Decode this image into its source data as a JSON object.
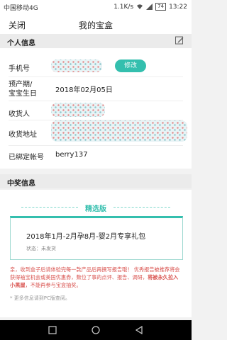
{
  "status_bar": {
    "carrier": "中国移动4G",
    "speed": "1.1K/s",
    "battery": "74",
    "time": "13:22"
  },
  "nav": {
    "close": "关闭",
    "title": "我的宝盒"
  },
  "personal": {
    "header": "个人信息",
    "phone_label": "手机号",
    "modify_button": "修改",
    "due_label_line1": "预产期/",
    "due_label_line2": "宝宝生日",
    "due_value": "2018年02月05日",
    "recipient_label": "收货人",
    "address_label": "收货地址",
    "account_label": "已绑定帐号",
    "account_value": "berry137"
  },
  "prize": {
    "header": "中奖信息",
    "tag": "精选版",
    "title": "2018年1月-2月孕8月-婴2月专享礼包",
    "status": "状态：未发货",
    "notice_prefix": "亲，收到盒子后请体验完每一款产品后再撰写报告哦！ 优秀报告被推荐将会获得袖宝机会或美国优惠券，数位了事的点评、报告、调研，",
    "notice_strong": "将被永久拉入小黑屋",
    "notice_suffix": "，不能再参与宝盒抽奖。",
    "footnote": "* 更多信息请到PC版查阅。"
  },
  "colors": {
    "accent": "#34bfae",
    "warning": "#d9534f"
  }
}
